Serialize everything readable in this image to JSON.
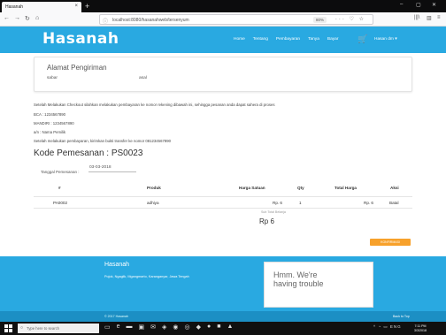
{
  "browser": {
    "tab_title": "Hasanah",
    "tab_close": "×",
    "new_tab": "+",
    "url": "localhost:8080/hasanahweb/tersenyum",
    "zoom": "80%",
    "url_actions": "··· ♡ ☆",
    "win_min": "–",
    "win_max": "▢",
    "win_close": "✕"
  },
  "nav": {
    "brand": "Hasanah",
    "links": [
      "Home",
      "Tentang",
      "Pembayaran",
      "Tanya",
      "Bayar"
    ],
    "user": "Hasan dm ▾"
  },
  "address": {
    "title": "Alamat Pengiriman",
    "line1": "sabar",
    "line2": "asal"
  },
  "payment_info": {
    "instruction": "Setelah Melakukan Checkout silahkan melakukan pembayaran ke nomor rekening dibawah ini, sehingga pesanan anda dapat sahera di proses",
    "bca": "BCA : 1234567890",
    "mandiri": "MANDIRI : 1234567890",
    "owner": "a/n : Nama Pemilik",
    "transfer": "Setelah melakukan pembayaran, kirimkan bukti transfer ke nomor 081234567890"
  },
  "order": {
    "code_label": "Kode Pemesanan : PS0023",
    "date_label": "Tanggal Pemesanan :",
    "date_value": "03-03-2018"
  },
  "table": {
    "headers": [
      "#",
      "Produk",
      "Harga Satuan",
      "Qty",
      "Total Harga",
      "Aksi"
    ],
    "rows": [
      {
        "no": "PA0002",
        "product": "adhiya",
        "unit_price": "Rp. 6",
        "qty": "1",
        "total": "Rp. 6",
        "action": "Batal"
      }
    ],
    "total_label": "Sub Total Belanja",
    "total_value": "Rp 6"
  },
  "confirm_label": "KONFIRMASI",
  "footer": {
    "brand": "Hasanah",
    "address": "Pojok, Ngaglik, Mgangmarto, Karanganyar, Jawa Tengah",
    "map_message": "Hmm. We're having trouble",
    "copyright": "© 2017 Hasanah",
    "back_to_top": "Back to Top"
  },
  "taskbar": {
    "search_placeholder": "Type here to search",
    "tray": "^ ◔ ▭ ENG",
    "time": "7:11 PM",
    "date": "3/3/2018"
  },
  "colors": {
    "brand_blue": "#29a9e1",
    "confirm_orange": "#f7a12b",
    "link_blue": "#29a9e1"
  }
}
